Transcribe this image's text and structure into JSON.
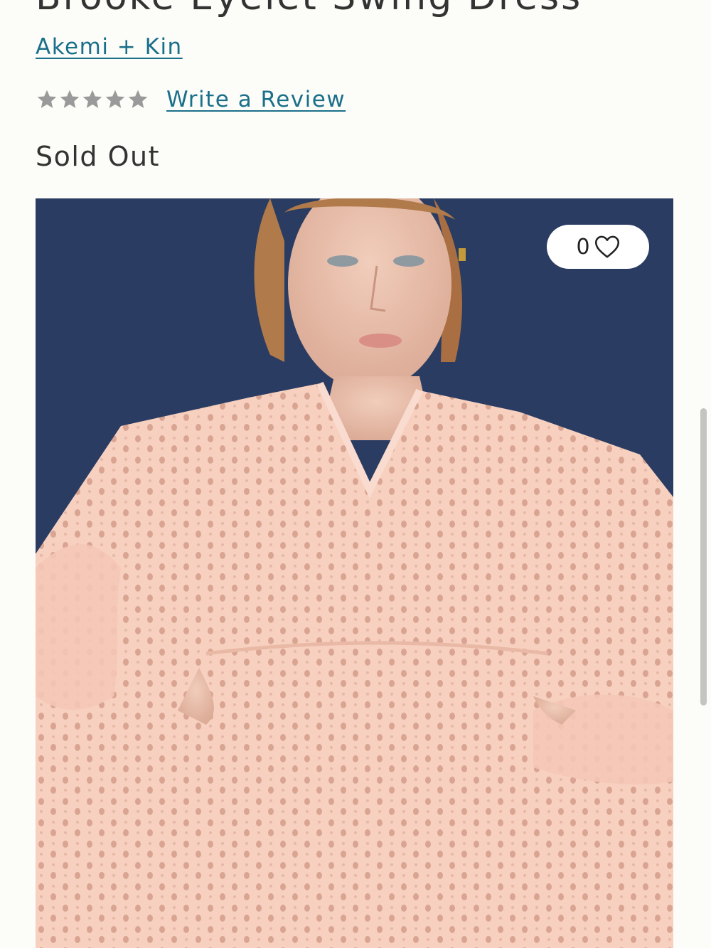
{
  "product": {
    "title": "Brooke Eyelet Swing Dress",
    "brand": "Akemi + Kin",
    "rating": {
      "stars_filled": 0,
      "stars_total": 5,
      "write_review_label": "Write a Review"
    },
    "status": "Sold Out"
  },
  "image": {
    "alt": "Model wearing a pale pink eyelet swing dress against a navy background",
    "favorites": {
      "count": "0",
      "icon": "heart-outline-icon"
    }
  },
  "colors": {
    "link": "#1a6f8a",
    "text": "#333333",
    "star": "#9a9a9a",
    "background": "#fcfcf8",
    "photo_backdrop": "#2a3c62",
    "dress": "#f6cdbd"
  }
}
